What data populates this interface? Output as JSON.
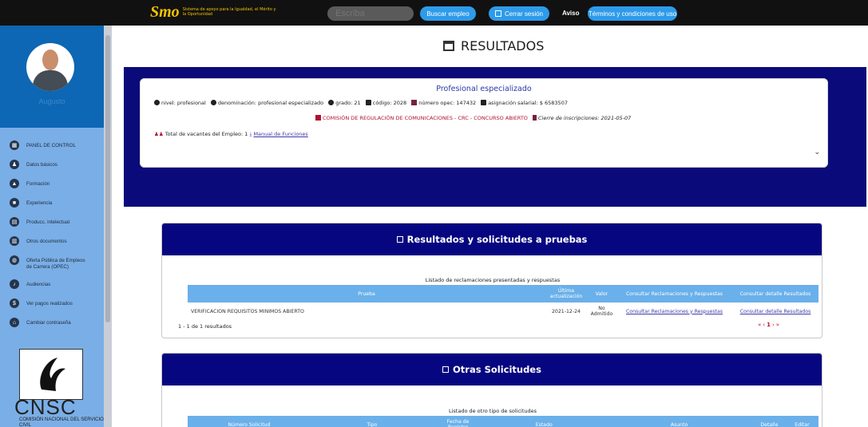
{
  "topbar": {
    "logo_mark": "Smo",
    "logo_text": "Sistema de apoyo para la Igualdad, el Mérito y la Oportunidad",
    "search_placeholder": "Escriba",
    "search_button": "Buscar empleo",
    "logout_button": "Cerrar sesión",
    "aviso": "Aviso",
    "terms_button": "Términos y condiciones de uso"
  },
  "sidebar": {
    "user_name": "Augusto",
    "items": [
      {
        "label": "PANEL DE CONTROL",
        "icon": "dashboard-icon",
        "glyph": "▦"
      },
      {
        "label": "Datos básicos",
        "icon": "people-icon",
        "glyph": "♟"
      },
      {
        "label": "Formación",
        "icon": "graduation-cap-icon",
        "glyph": "▲"
      },
      {
        "label": "Experiencia",
        "icon": "briefcase-icon",
        "glyph": "■"
      },
      {
        "label": "Producc. intelectual",
        "icon": "book-icon",
        "glyph": "▤"
      },
      {
        "label": "Otros documentos",
        "icon": "document-icon",
        "glyph": "▥"
      },
      {
        "label": "Oferta Pública de Empleos de Carrera (OPEC)",
        "icon": "globe-icon",
        "glyph": "◍"
      },
      {
        "label": "Audiencias",
        "icon": "audience-icon",
        "glyph": "♪"
      },
      {
        "label": "Ver pagos realizados",
        "icon": "dollar-icon",
        "glyph": "$"
      },
      {
        "label": "Cambiar contraseña",
        "icon": "lock-icon",
        "glyph": "⌂"
      }
    ],
    "org_short": "CNSC",
    "org_long": "COMISIÓN NACIONAL DEL SERVICIO CIVIL"
  },
  "main": {
    "title": "RESULTADOS",
    "job": {
      "title": "Profesional especializado",
      "nivel": "nivel: profesional",
      "denominacion": "denominación: profesional especializado",
      "grado": "grado: 21",
      "codigo": "código: 2028",
      "opec": "número opec: 147432",
      "salario": "asignación salarial: $ 6583507",
      "entidad": "COMISIÓN DE REGULACIÓN DE COMUNICACIONES - CRC - CONCURSO ABIERTO",
      "cierre": "Cierre de inscripciones: 2021-05-07",
      "vacantes": "Total de vacantes del Empleo: 1",
      "manual": "Manual de Funciones"
    },
    "results_panel": {
      "heading": "Resultados y solicitudes a pruebas",
      "caption": "Listado de reclamaciones presentadas y respuestas",
      "columns": [
        "Prueba",
        "Última actualización",
        "Valor",
        "Consultar Reclamaciones y Respuestas",
        "Consultar detalle Resultados"
      ],
      "rows": [
        {
          "prueba": "VERIFICACION REQUISITOS MINIMOS ABIERTO",
          "fecha": "2021-12-24",
          "valor": "No Admitido",
          "reclamaciones": "Consultar Reclamaciones y Respuestas",
          "detalle": "Consultar detalle Resultados"
        }
      ],
      "count_text": "1 - 1 de 1 resultados",
      "pager_first": "«",
      "pager_prev": "‹",
      "pager_current": "1",
      "pager_next": "›",
      "pager_last": "»"
    },
    "other_panel": {
      "heading": "Otras Solicitudes",
      "caption": "Listado de otro tipo de solicitudes",
      "columns": [
        "Número Solicitud",
        "Tipo",
        "Fecha de Registro",
        "Estado",
        "Asunto",
        "Detalle",
        "Editar"
      ]
    }
  }
}
